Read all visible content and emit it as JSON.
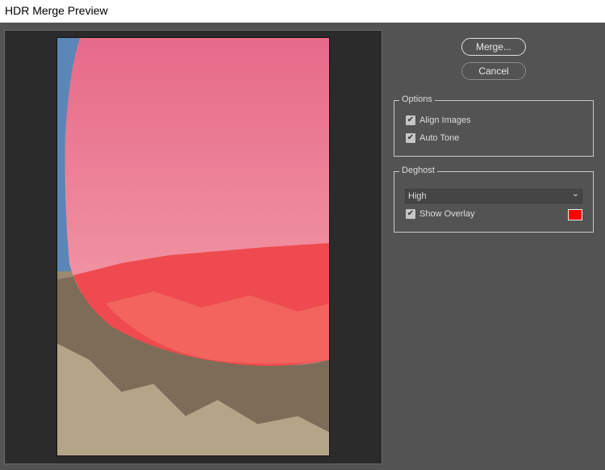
{
  "window": {
    "title": "HDR Merge Preview"
  },
  "buttons": {
    "merge": "Merge...",
    "cancel": "Cancel"
  },
  "options": {
    "title": "Options",
    "align_images": {
      "label": "Align Images",
      "checked": true
    },
    "auto_tone": {
      "label": "Auto Tone",
      "checked": true
    }
  },
  "deghost": {
    "title": "Deghost",
    "level": "High",
    "show_overlay": {
      "label": "Show Overlay",
      "checked": true
    },
    "overlay_color": "#ff0000"
  },
  "icons": {
    "check": "✔",
    "chevron": "⌄"
  }
}
